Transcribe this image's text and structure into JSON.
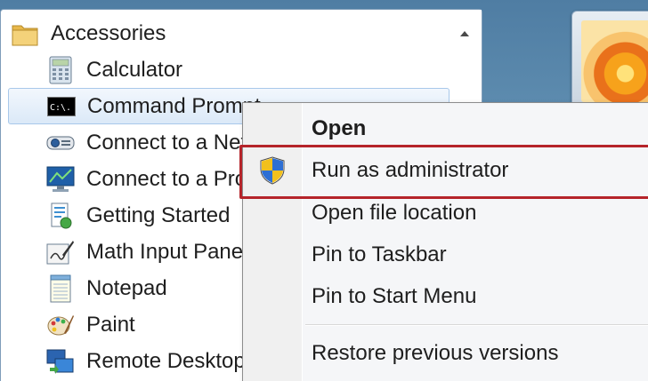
{
  "programs": {
    "folder": {
      "label": "Accessories",
      "icon": "folder-icon"
    },
    "items": [
      {
        "label": "Calculator",
        "icon": "calculator-icon"
      },
      {
        "label": "Command Prompt",
        "icon": "command-prompt-icon"
      },
      {
        "label": "Connect to a Network Projector",
        "icon": "network-projector-icon"
      },
      {
        "label": "Connect to a Projector",
        "icon": "projector-icon"
      },
      {
        "label": "Getting Started",
        "icon": "getting-started-icon"
      },
      {
        "label": "Math Input Panel",
        "icon": "math-input-icon"
      },
      {
        "label": "Notepad",
        "icon": "notepad-icon"
      },
      {
        "label": "Paint",
        "icon": "paint-icon"
      },
      {
        "label": "Remote Desktop Connection",
        "icon": "remote-desktop-icon"
      }
    ],
    "hovered_index": 1
  },
  "context_menu": {
    "items": [
      {
        "label": "Open",
        "bold": true
      },
      {
        "label": "Run as administrator",
        "icon": "uac-shield-icon",
        "highlighted": true
      },
      {
        "label": "Open file location"
      },
      {
        "label": "Pin to Taskbar"
      },
      {
        "label": "Pin to Start Menu"
      },
      {
        "label": "Restore previous versions"
      }
    ]
  },
  "colors": {
    "highlight_border": "#b5242a",
    "hover_fill": "#dbe9f8",
    "menu_background": "#f5f6f8"
  }
}
